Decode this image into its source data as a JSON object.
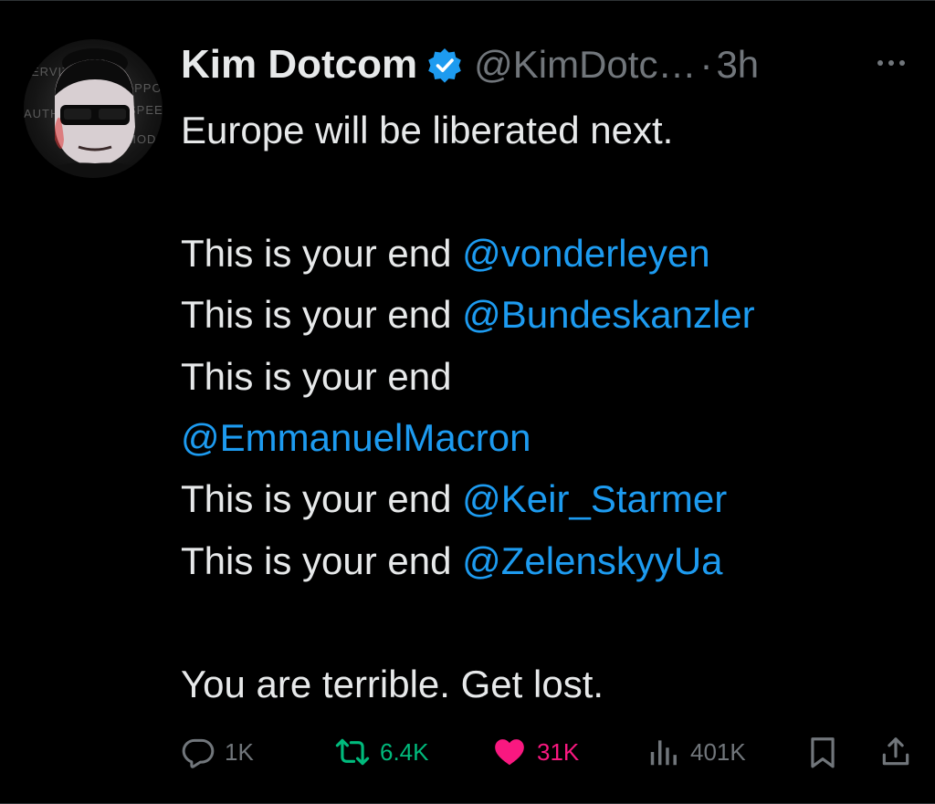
{
  "author": {
    "name": "Kim Dotcom",
    "handle": "@KimDotc…",
    "separator": "·",
    "time": "3h"
  },
  "icons": {
    "verified": "verified-badge-icon",
    "more": "more-options-icon",
    "reply": "reply-icon",
    "repost": "repost-icon",
    "like": "heart-icon",
    "views": "views-icon",
    "bookmark": "bookmark-icon",
    "share": "share-icon"
  },
  "colors": {
    "background": "#000000",
    "text": "#e7e9ea",
    "muted": "#71767b",
    "mention": "#1d9bf0",
    "verified": "#1d9bf0",
    "repost_active": "#00ba7c",
    "like_active": "#f91880"
  },
  "tweet": {
    "line1": "Europe will be liberated next.",
    "prefix": "This is your end ",
    "prefix_bare": "This is your end",
    "mention1": "@vonderleyen",
    "mention2": "@Bundeskanzler",
    "mention3": "@EmmanuelMacron",
    "mention4": "@Keir_Starmer",
    "mention5": "@ZelenskyyUa",
    "closing": "You are terrible. Get lost."
  },
  "stats": {
    "replies": "1K",
    "reposts": "6.4K",
    "likes": "31K",
    "views": "401K"
  }
}
